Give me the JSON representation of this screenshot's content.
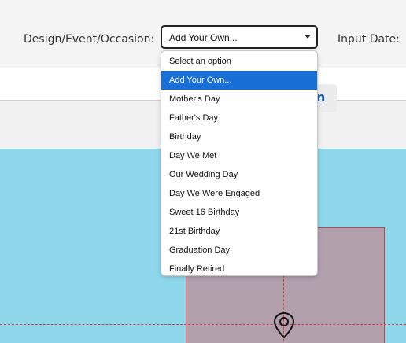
{
  "header": {
    "occasion_label": "Design/Event/Occasion:",
    "input_date_label": "Input Date:"
  },
  "occasion_select": {
    "value": "Add Your Own...",
    "options": [
      "Select an option",
      "Add Your Own...",
      "Mother's Day",
      "Father's Day",
      "Birthday",
      "Day We Met",
      "Our Wedding Day",
      "Day We Were Engaged",
      "Sweet 16 Birthday",
      "21st Birthday",
      "Graduation Day",
      "Finally Retired"
    ],
    "selected_index": 1
  },
  "partial_button": {
    "label_fragment": "n"
  },
  "colors": {
    "accent": "#1a6fd6",
    "canvas_background": "#8fd8ec",
    "guide_line": "#d6383d",
    "design_area": "#b3a0ad"
  },
  "icons": {
    "select_arrow": "triangle-down",
    "location": "map-pin-icon"
  }
}
